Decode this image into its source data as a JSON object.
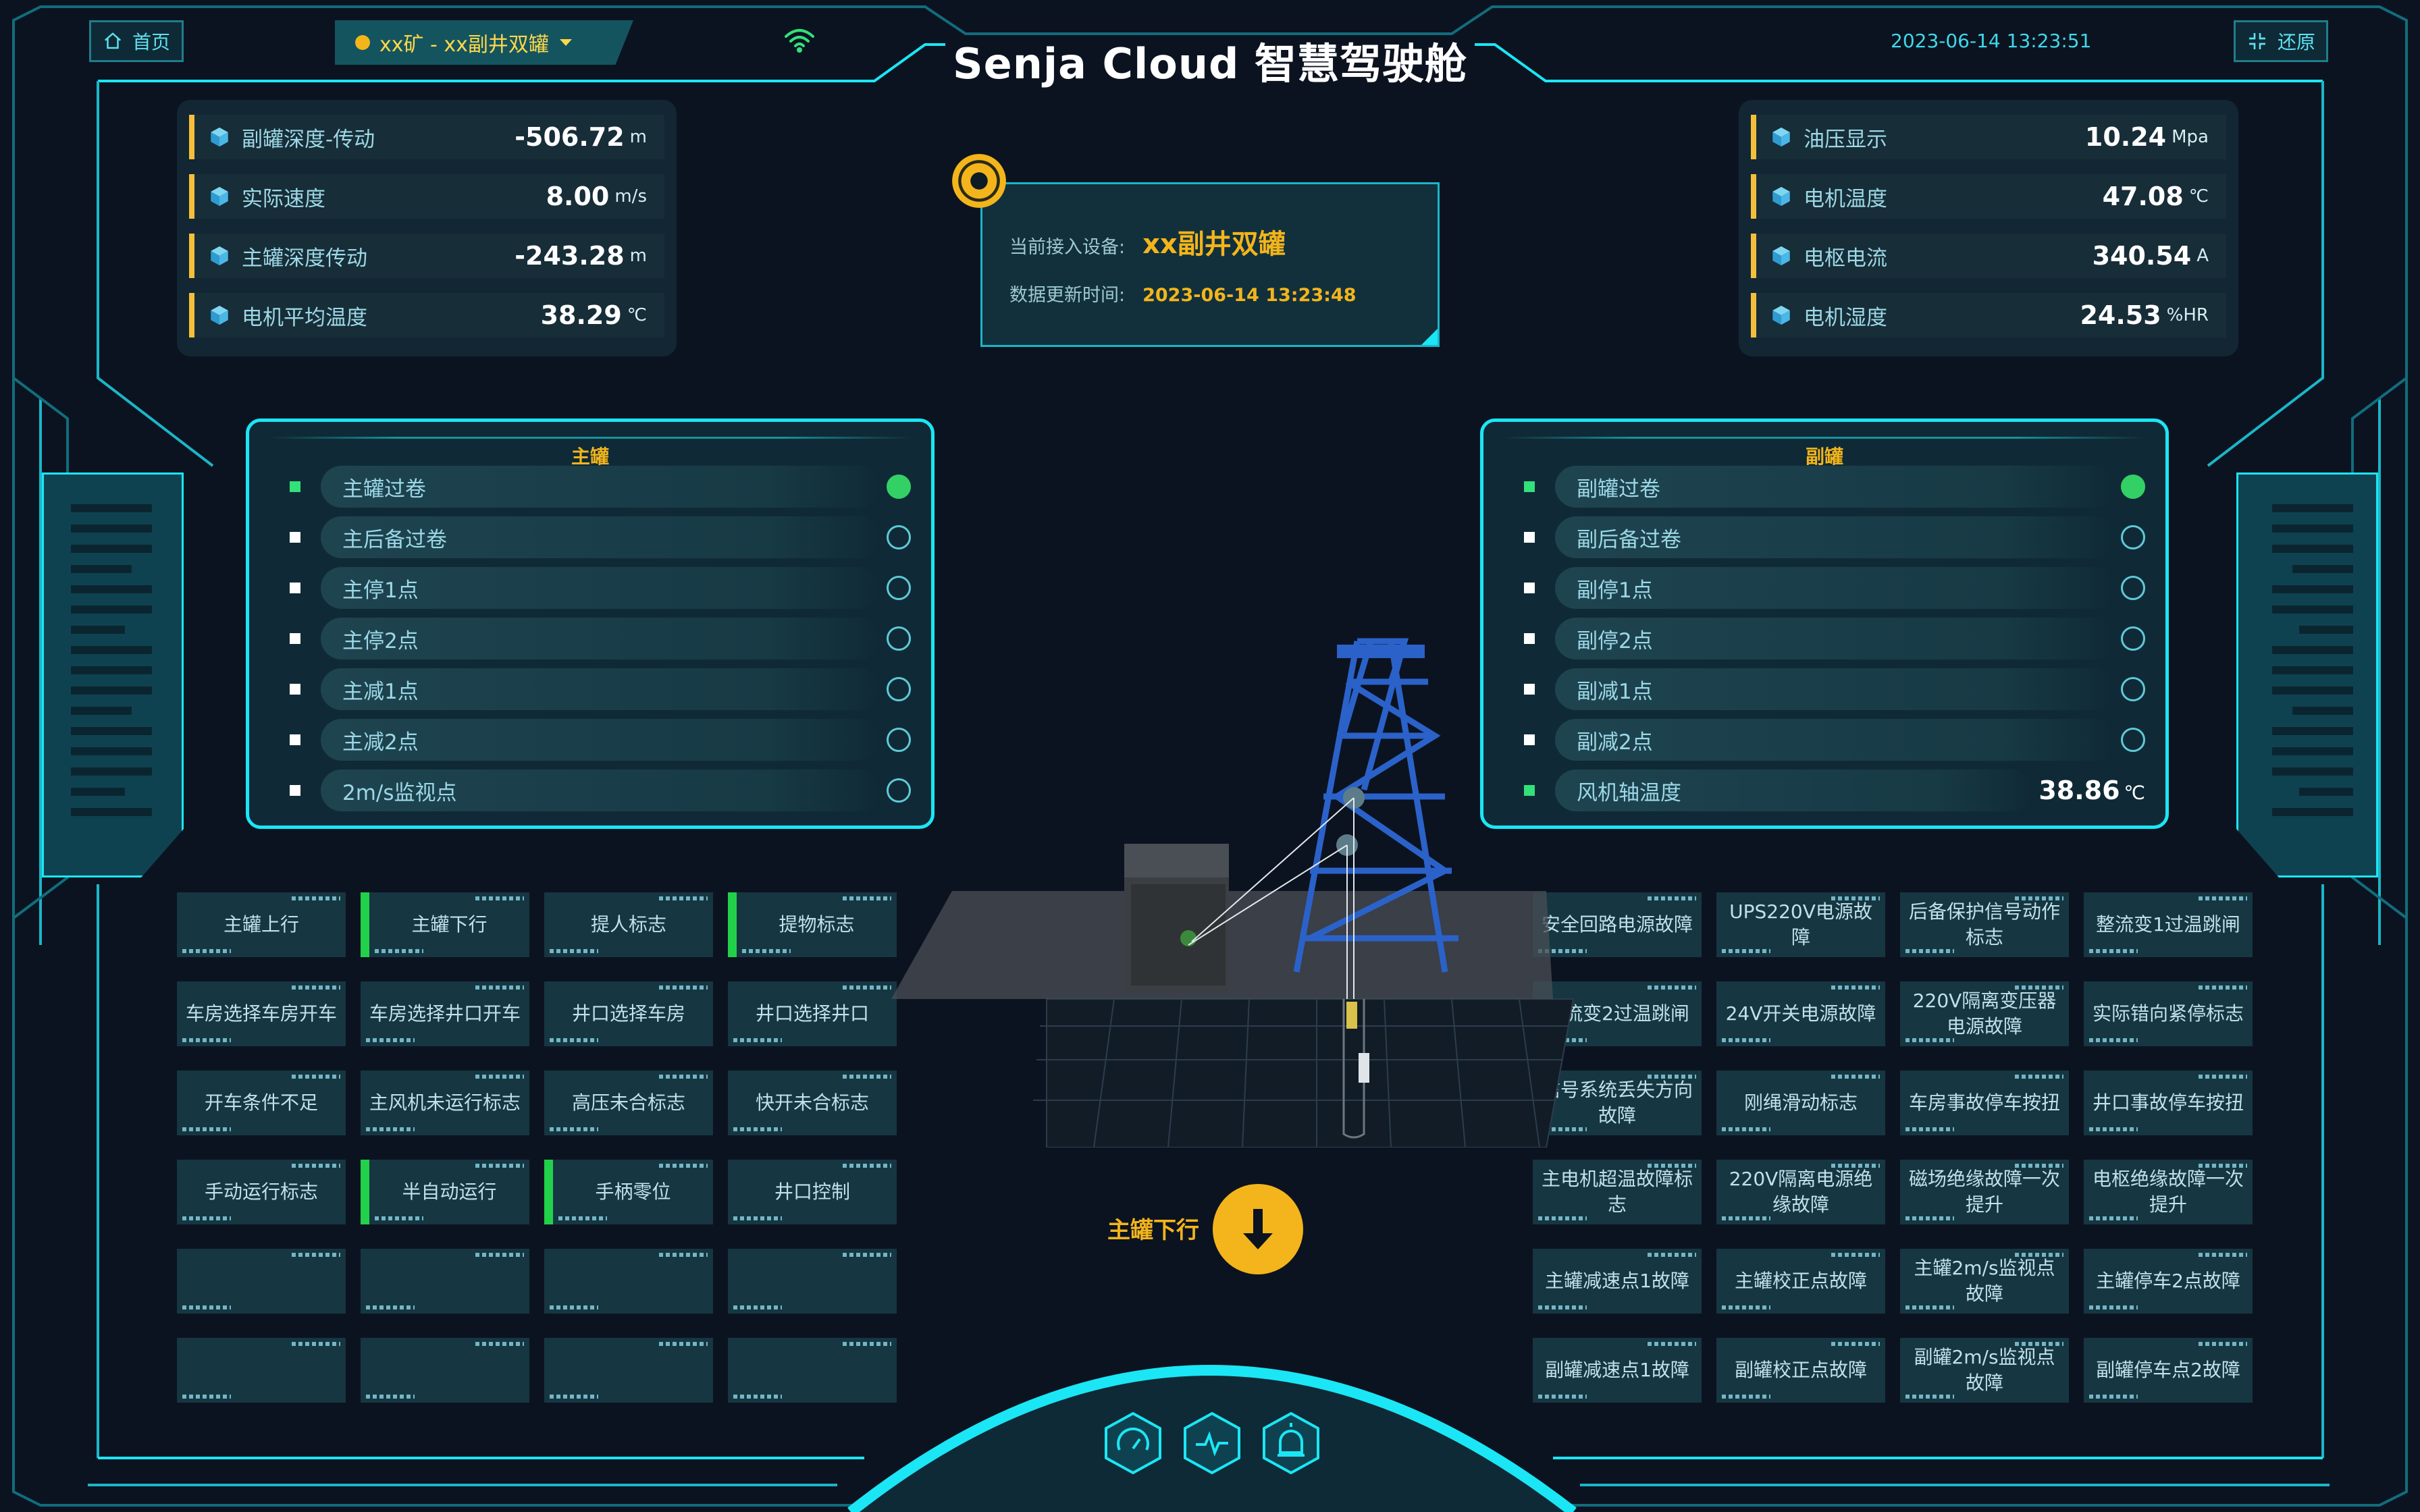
{
  "header": {
    "home_label": "首页",
    "mine_select": "xx矿 - xx副井双罐",
    "title": "Senja Cloud 智慧驾驶舱",
    "datetime": "2023-06-14 13:23:51",
    "restore_label": "还原"
  },
  "metrics_left": [
    {
      "label": "副罐深度-传动",
      "value": "-506.72",
      "unit": "m"
    },
    {
      "label": "实际速度",
      "value": "8.00",
      "unit": "m/s"
    },
    {
      "label": "主罐深度传动",
      "value": "-243.28",
      "unit": "m"
    },
    {
      "label": "电机平均温度",
      "value": "38.29",
      "unit": "℃"
    }
  ],
  "metrics_right": [
    {
      "label": "油压显示",
      "value": "10.24",
      "unit": "Mpa"
    },
    {
      "label": "电机温度",
      "value": "47.08",
      "unit": "℃"
    },
    {
      "label": "电枢电流",
      "value": "340.54",
      "unit": "A"
    },
    {
      "label": "电机湿度",
      "value": "24.53",
      "unit": "%HR"
    }
  ],
  "device": {
    "current_label": "当前接入设备:",
    "current_value": "xx副井双罐",
    "update_label": "数据更新时间:",
    "update_value": "2023-06-14 13:23:48"
  },
  "main_panel": {
    "title": "主罐",
    "items": [
      {
        "label": "主罐过卷",
        "on": true
      },
      {
        "label": "主后备过卷",
        "on": false
      },
      {
        "label": "主停1点",
        "on": false
      },
      {
        "label": "主停2点",
        "on": false
      },
      {
        "label": "主减1点",
        "on": false
      },
      {
        "label": "主减2点",
        "on": false
      },
      {
        "label": "2m/s监视点",
        "on": false
      }
    ]
  },
  "aux_panel": {
    "title": "副罐",
    "items": [
      {
        "label": "副罐过卷",
        "on": true
      },
      {
        "label": "副后备过卷",
        "on": false
      },
      {
        "label": "副停1点",
        "on": false
      },
      {
        "label": "副停2点",
        "on": false
      },
      {
        "label": "副减1点",
        "on": false
      },
      {
        "label": "副减2点",
        "on": false
      }
    ],
    "fan_label": "风机轴温度",
    "fan_value": "38.86",
    "fan_unit": "℃"
  },
  "left_buttons": [
    {
      "label": "主罐上行",
      "active": false
    },
    {
      "label": "主罐下行",
      "active": true
    },
    {
      "label": "提人标志",
      "active": false
    },
    {
      "label": "提物标志",
      "active": true
    },
    {
      "label": "车房选择车房开车",
      "active": false
    },
    {
      "label": "车房选择井口开车",
      "active": false
    },
    {
      "label": "井口选择车房",
      "active": false
    },
    {
      "label": "井口选择井口",
      "active": false
    },
    {
      "label": "开车条件不足",
      "active": false
    },
    {
      "label": "主风机未运行标志",
      "active": false
    },
    {
      "label": "高压未合标志",
      "active": false
    },
    {
      "label": "快开未合标志",
      "active": false
    },
    {
      "label": "手动运行标志",
      "active": false
    },
    {
      "label": "半自动运行",
      "active": true
    },
    {
      "label": "手柄零位",
      "active": true
    },
    {
      "label": "井口控制",
      "active": false
    },
    {
      "label": "",
      "active": false
    },
    {
      "label": "",
      "active": false
    },
    {
      "label": "",
      "active": false
    },
    {
      "label": "",
      "active": false
    },
    {
      "label": "",
      "active": false
    },
    {
      "label": "",
      "active": false
    },
    {
      "label": "",
      "active": false
    },
    {
      "label": "",
      "active": false
    }
  ],
  "right_buttons": [
    {
      "label": "安全回路电源故障"
    },
    {
      "label": "UPS220V电源故障"
    },
    {
      "label": "后备保护信号动作标志"
    },
    {
      "label": "整流变1过温跳闸"
    },
    {
      "label": "整流变2过温跳闸"
    },
    {
      "label": "24V开关电源故障"
    },
    {
      "label": "220V隔离变压器电源故障"
    },
    {
      "label": "实际错向紧停标志"
    },
    {
      "label": "信号系统丢失方向故障"
    },
    {
      "label": "刚绳滑动标志"
    },
    {
      "label": "车房事故停车按扭"
    },
    {
      "label": "井口事故停车按扭"
    },
    {
      "label": "主电机超温故障标志"
    },
    {
      "label": "220V隔离电源绝缘故障"
    },
    {
      "label": "磁场绝缘故障一次提升"
    },
    {
      "label": "电枢绝缘故障一次提升"
    },
    {
      "label": "主罐减速点1故障"
    },
    {
      "label": "主罐校正点故障"
    },
    {
      "label": "主罐2m/s监视点故障"
    },
    {
      "label": "主罐停车2点故障"
    },
    {
      "label": "副罐减速点1故障"
    },
    {
      "label": "副罐校正点故障"
    },
    {
      "label": "副罐2m/s监视点故障"
    },
    {
      "label": "副罐停车点2故障"
    }
  ],
  "direction": {
    "label": "主罐下行"
  },
  "icons": {
    "home": "home-icon",
    "wifi": "wifi-icon",
    "restore": "restore-icon",
    "cube": "cube-icon",
    "arrow": "arrow-down-icon",
    "gauge": "gauge-icon",
    "wave": "pulse-icon",
    "alarm": "alarm-icon"
  },
  "colors": {
    "accent": "#1be6f5",
    "highlight": "#f3b51b",
    "active": "#22d14a",
    "background": "#0c1320"
  }
}
